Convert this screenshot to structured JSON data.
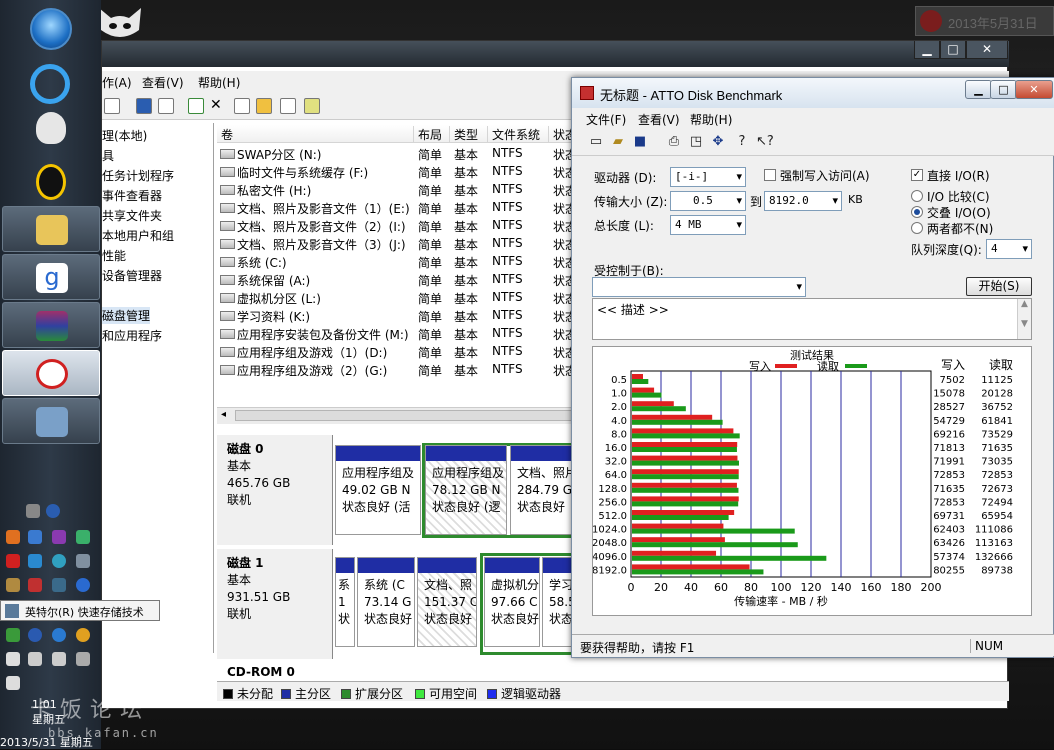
{
  "desktop": {
    "date_widget": "2013年5月31日"
  },
  "taskbar": {
    "tray_tooltip": "英特尔(R) 快速存储技术",
    "clock_time": "1:01",
    "clock_day": "星期五",
    "clock_date": "2013/5/31 星期五",
    "watermark": "卡饭论坛",
    "watermark_url": "bbs.kafan.cn"
  },
  "computer_mgmt": {
    "menu": {
      "action": "作(A)",
      "view": "查看(V)",
      "help": "帮助(H)"
    },
    "tree": [
      "理(本地)",
      "具",
      "任务计划程序",
      "事件查看器",
      "共享文件夹",
      "本地用户和组",
      "性能",
      "设备管理器",
      "",
      "磁盘管理",
      "和应用程序"
    ],
    "columns": [
      "卷",
      "布局",
      "类型",
      "文件系统",
      "状态"
    ],
    "volumes": [
      {
        "name": "SWAP分区 (N:)",
        "layout": "简单",
        "type": "基本",
        "fs": "NTFS",
        "status": "状态"
      },
      {
        "name": "临时文件与系统缓存 (F:)",
        "layout": "简单",
        "type": "基本",
        "fs": "NTFS",
        "status": "状态"
      },
      {
        "name": "私密文件 (H:)",
        "layout": "简单",
        "type": "基本",
        "fs": "NTFS",
        "status": "状态"
      },
      {
        "name": "文档、照片及影音文件（1）(E:)",
        "layout": "简单",
        "type": "基本",
        "fs": "NTFS",
        "status": "状态"
      },
      {
        "name": "文档、照片及影音文件（2）(I:)",
        "layout": "简单",
        "type": "基本",
        "fs": "NTFS",
        "status": "状态"
      },
      {
        "name": "文档、照片及影音文件（3）(J:)",
        "layout": "简单",
        "type": "基本",
        "fs": "NTFS",
        "status": "状态"
      },
      {
        "name": "系统 (C:)",
        "layout": "简单",
        "type": "基本",
        "fs": "NTFS",
        "status": "状态"
      },
      {
        "name": "系统保留 (A:)",
        "layout": "简单",
        "type": "基本",
        "fs": "NTFS",
        "status": "状态"
      },
      {
        "name": "虚拟机分区 (L:)",
        "layout": "简单",
        "type": "基本",
        "fs": "NTFS",
        "status": "状态"
      },
      {
        "name": "学习资料 (K:)",
        "layout": "简单",
        "type": "基本",
        "fs": "NTFS",
        "status": "状态"
      },
      {
        "name": "应用程序安装包及备份文件 (M:)",
        "layout": "简单",
        "type": "基本",
        "fs": "NTFS",
        "status": "状态"
      },
      {
        "name": "应用程序组及游戏（1）(D:)",
        "layout": "简单",
        "type": "基本",
        "fs": "NTFS",
        "status": "状态"
      },
      {
        "name": "应用程序组及游戏（2）(G:)",
        "layout": "简单",
        "type": "基本",
        "fs": "NTFS",
        "status": "状态"
      }
    ],
    "disk0": {
      "name": "磁盘 0",
      "type": "基本",
      "size": "465.76 GB",
      "state": "联机",
      "parts": [
        {
          "title": "应用程序组及",
          "size": "49.02 GB N",
          "status": "状态良好 (活"
        },
        {
          "title": "应用程序组及",
          "size": "78.12 GB N",
          "status": "状态良好 (逻"
        },
        {
          "title": "文档、照片",
          "size": "284.79 GB",
          "status": "状态良好"
        }
      ]
    },
    "disk1": {
      "name": "磁盘 1",
      "type": "基本",
      "size": "931.51 GB",
      "state": "联机",
      "parts": [
        {
          "title": "系",
          "size": "1",
          "status": "状"
        },
        {
          "title": "系统 (C",
          "size": "73.14 G",
          "status": "状态良好"
        },
        {
          "title": "文档、照",
          "size": "151.37 C",
          "status": "状态良好"
        },
        {
          "title": "虚拟机分",
          "size": "97.66 C",
          "status": "状态良好"
        },
        {
          "title": "学习",
          "size": "58.5",
          "status": "状态"
        }
      ]
    },
    "cdrom": "CD-ROM 0",
    "legend": [
      {
        "label": "未分配",
        "color": "#000000"
      },
      {
        "label": "主分区",
        "color": "#1f2da4"
      },
      {
        "label": "扩展分区",
        "color": "#2e8b2e"
      },
      {
        "label": "可用空间",
        "color": "#3ee83e"
      },
      {
        "label": "逻辑驱动器",
        "color": "#1f2df0"
      }
    ]
  },
  "atto": {
    "title": "无标题 - ATTO Disk Benchmark",
    "menu": {
      "file": "文件(F)",
      "view": "查看(V)",
      "help": "帮助(H)"
    },
    "drive_label": "驱动器 (D):",
    "drive_value": "[-i-]",
    "force_write_label": "强制写入访问(A)",
    "direct_io_label": "直接 I/O(R)",
    "transfer_label": "传输大小 (Z):",
    "transfer_from": "0.5",
    "transfer_to_label": "到",
    "transfer_to": "8192.0",
    "transfer_unit": "KB",
    "total_label": "总长度 (L):",
    "total_value": "4 MB",
    "io_compare": "I/O 比较(C)",
    "overlapped_io": "交叠 I/O(O)",
    "neither": "两者都不(N)",
    "queue_label": "队列深度(Q):",
    "queue_value": "4",
    "controlled_label": "受控制于(B):",
    "start_button": "开始(S)",
    "description": "<< 描述 >>",
    "results_title": "测试结果",
    "write_legend": "写入",
    "read_legend": "读取",
    "col_write": "写入",
    "col_read": "读取",
    "status_help": "要获得帮助，请按 F1",
    "status_num": "NUM"
  },
  "chart_data": {
    "type": "bar",
    "title": "测试结果",
    "xlabel": "传输速率 - MB / 秒",
    "xlim": [
      0,
      200
    ],
    "xticks": [
      0,
      20,
      40,
      60,
      80,
      100,
      120,
      140,
      160,
      180,
      200
    ],
    "categories": [
      "0.5",
      "1.0",
      "2.0",
      "4.0",
      "8.0",
      "16.0",
      "32.0",
      "64.0",
      "128.0",
      "256.0",
      "512.0",
      "1024.0",
      "2048.0",
      "4096.0",
      "8192.0"
    ],
    "series": [
      {
        "name": "写入",
        "color": "#e02020",
        "values": [
          7502,
          15078,
          28527,
          54729,
          69216,
          71813,
          71991,
          72853,
          71635,
          72853,
          69731,
          62403,
          63426,
          57374,
          80255
        ]
      },
      {
        "name": "读取",
        "color": "#1a9a1a",
        "values": [
          11125,
          20128,
          36752,
          61841,
          73529,
          71635,
          73035,
          72853,
          72673,
          72494,
          65954,
          111086,
          113163,
          132666,
          89738
        ]
      }
    ]
  }
}
